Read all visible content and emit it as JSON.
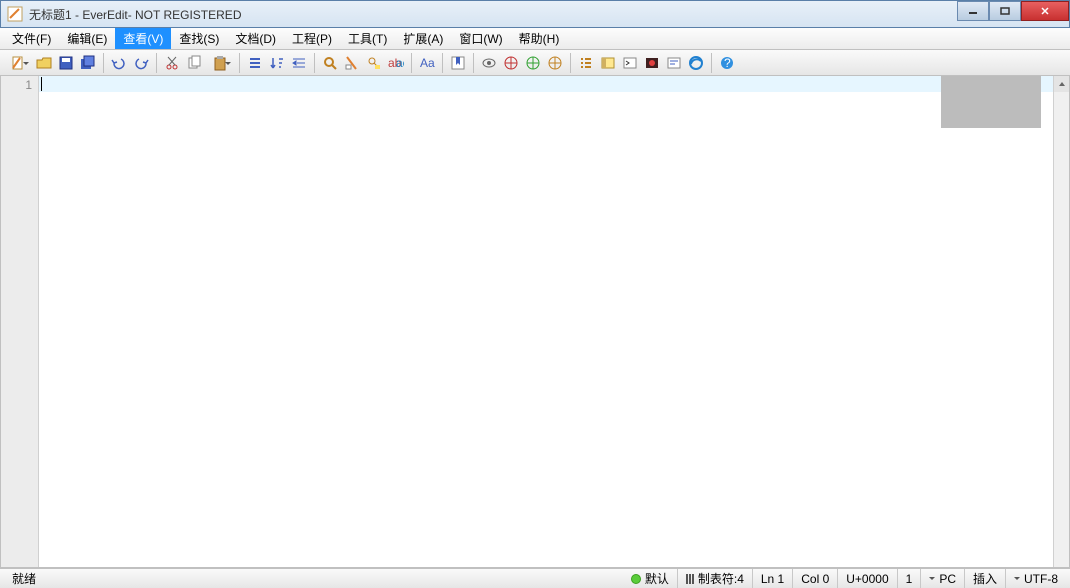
{
  "title": "无标题1 - EverEdit- NOT REGISTERED",
  "menus": [
    "文件(F)",
    "编辑(E)",
    "查看(V)",
    "查找(S)",
    "文档(D)",
    "工程(P)",
    "工具(T)",
    "扩展(A)",
    "窗口(W)",
    "帮助(H)"
  ],
  "active_menu_index": 2,
  "gutter": {
    "line1": "1"
  },
  "status": {
    "ready": "就绪",
    "mode": "默认",
    "tabstop": "制表符:4",
    "line": "Ln 1",
    "col": "Col 0",
    "unicode": "U+0000",
    "count": "1",
    "eol": "PC",
    "ins": "插入",
    "enc": "UTF-8"
  },
  "toolbar_icons": [
    "new",
    "open",
    "save",
    "saveall",
    "|",
    "undo",
    "redo",
    "|",
    "cut",
    "copy",
    "paste",
    "|",
    "list",
    "sort",
    "indent",
    "|",
    "find",
    "replace",
    "findreplace",
    "highlight",
    "|",
    "case",
    "|",
    "bookmark",
    "|",
    "eye",
    "web1",
    "web2",
    "web3",
    "|",
    "listview",
    "panel",
    "terminal",
    "record",
    "output",
    "ie",
    "|",
    "help"
  ]
}
